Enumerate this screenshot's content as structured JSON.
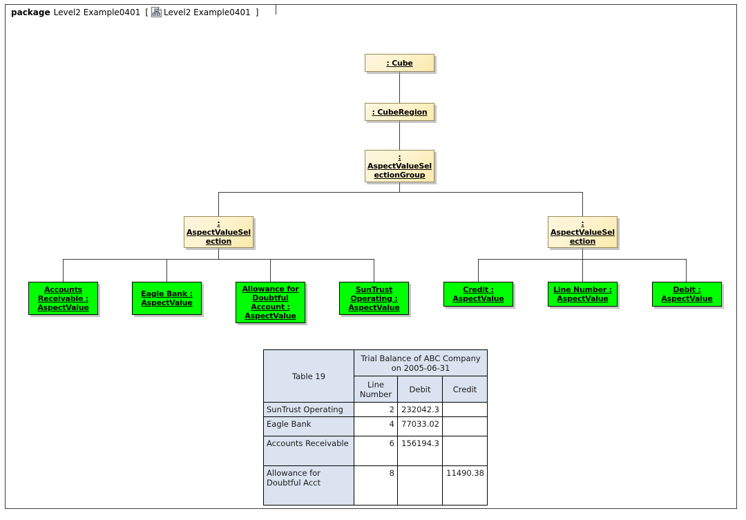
{
  "frame": {
    "keyword": "package",
    "name": "Level2 Example0401",
    "bracket_open": "[",
    "bracket_close": "]",
    "diagram_name": "Level2 Example0401",
    "icon": "diagram-hierarchy-icon"
  },
  "nodes": [
    {
      "id": "cube",
      "label": ": Cube"
    },
    {
      "id": "cuberegion",
      "label": ": CubeRegion"
    },
    {
      "id": "avsgroup",
      "label": ":\nAspectValueSelectionGroup",
      "lines": [
        ":",
        "AspectValueSel",
        "ectionGroup"
      ]
    },
    {
      "id": "avsleft",
      "label": ":\nAspectValueSelection",
      "lines": [
        ":",
        "AspectValueSel",
        "ection"
      ]
    },
    {
      "id": "avsright",
      "label": ":\nAspectValueSelection",
      "lines": [
        ":",
        "AspectValueSel",
        "ection"
      ]
    }
  ],
  "value_nodes": [
    {
      "id": "accounts-receivable",
      "lines": [
        "Accounts",
        "Receivable :",
        "AspectValue"
      ]
    },
    {
      "id": "eagle-bank",
      "lines": [
        "Eagle Bank :",
        "AspectValue"
      ]
    },
    {
      "id": "allowance",
      "lines": [
        "Allowance for",
        "Doubtful",
        "Account :",
        "AspectValue"
      ]
    },
    {
      "id": "suntrust",
      "lines": [
        "SunTrust",
        "Operating :",
        "AspectValue"
      ]
    },
    {
      "id": "credit",
      "lines": [
        "Credit :",
        "AspectValue"
      ]
    },
    {
      "id": "line-number",
      "lines": [
        "Line Number :",
        "AspectValue"
      ]
    },
    {
      "id": "debit",
      "lines": [
        "Debit :",
        "AspectValue"
      ]
    }
  ],
  "table": {
    "corner_label": "Table 19",
    "title": "Trial Balance of ABC Company on 2005-06-31",
    "columns": [
      "Line Number",
      "Debit",
      "Credit"
    ],
    "rows": [
      {
        "label": "SunTrust Operating",
        "line_number": "2",
        "debit": "232042.3",
        "credit": ""
      },
      {
        "label": "Eagle Bank",
        "line_number": "4",
        "debit": "77033.02",
        "credit": ""
      },
      {
        "label": "Accounts Receivable",
        "line_number": "6",
        "debit": "156194.3",
        "credit": ""
      },
      {
        "label": "Allowance for Doubtful Acct",
        "line_number": "8",
        "debit": "",
        "credit": "11490.38"
      }
    ]
  },
  "colors": {
    "node_fill": "#fdf3cf",
    "node_border": "#9a8a5a",
    "value_fill": "#00ff00",
    "value_border": "#000000",
    "line": "#3b3b3b",
    "table_header_fill": "#dae3ef",
    "frame_border": "#3b3b3b"
  }
}
